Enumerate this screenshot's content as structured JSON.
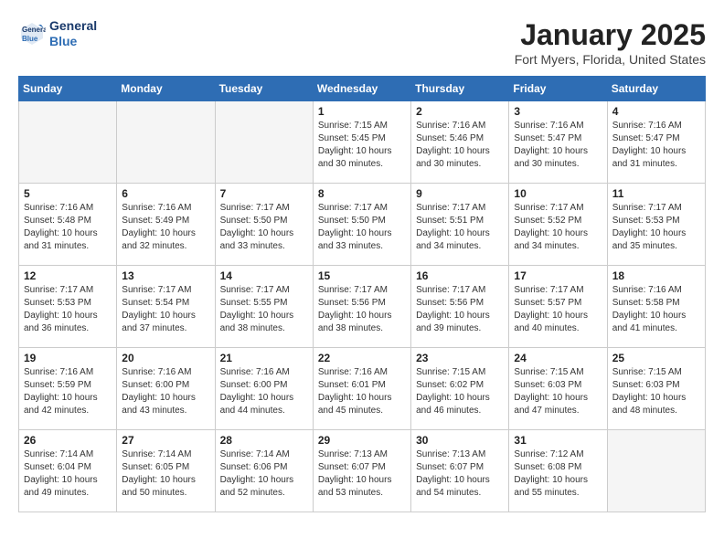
{
  "header": {
    "logo_general": "General",
    "logo_blue": "Blue",
    "title": "January 2025",
    "subtitle": "Fort Myers, Florida, United States"
  },
  "weekdays": [
    "Sunday",
    "Monday",
    "Tuesday",
    "Wednesday",
    "Thursday",
    "Friday",
    "Saturday"
  ],
  "weeks": [
    [
      {
        "day": "",
        "info": ""
      },
      {
        "day": "",
        "info": ""
      },
      {
        "day": "",
        "info": ""
      },
      {
        "day": "1",
        "info": "Sunrise: 7:15 AM\nSunset: 5:45 PM\nDaylight: 10 hours\nand 30 minutes."
      },
      {
        "day": "2",
        "info": "Sunrise: 7:16 AM\nSunset: 5:46 PM\nDaylight: 10 hours\nand 30 minutes."
      },
      {
        "day": "3",
        "info": "Sunrise: 7:16 AM\nSunset: 5:47 PM\nDaylight: 10 hours\nand 30 minutes."
      },
      {
        "day": "4",
        "info": "Sunrise: 7:16 AM\nSunset: 5:47 PM\nDaylight: 10 hours\nand 31 minutes."
      }
    ],
    [
      {
        "day": "5",
        "info": "Sunrise: 7:16 AM\nSunset: 5:48 PM\nDaylight: 10 hours\nand 31 minutes."
      },
      {
        "day": "6",
        "info": "Sunrise: 7:16 AM\nSunset: 5:49 PM\nDaylight: 10 hours\nand 32 minutes."
      },
      {
        "day": "7",
        "info": "Sunrise: 7:17 AM\nSunset: 5:50 PM\nDaylight: 10 hours\nand 33 minutes."
      },
      {
        "day": "8",
        "info": "Sunrise: 7:17 AM\nSunset: 5:50 PM\nDaylight: 10 hours\nand 33 minutes."
      },
      {
        "day": "9",
        "info": "Sunrise: 7:17 AM\nSunset: 5:51 PM\nDaylight: 10 hours\nand 34 minutes."
      },
      {
        "day": "10",
        "info": "Sunrise: 7:17 AM\nSunset: 5:52 PM\nDaylight: 10 hours\nand 34 minutes."
      },
      {
        "day": "11",
        "info": "Sunrise: 7:17 AM\nSunset: 5:53 PM\nDaylight: 10 hours\nand 35 minutes."
      }
    ],
    [
      {
        "day": "12",
        "info": "Sunrise: 7:17 AM\nSunset: 5:53 PM\nDaylight: 10 hours\nand 36 minutes."
      },
      {
        "day": "13",
        "info": "Sunrise: 7:17 AM\nSunset: 5:54 PM\nDaylight: 10 hours\nand 37 minutes."
      },
      {
        "day": "14",
        "info": "Sunrise: 7:17 AM\nSunset: 5:55 PM\nDaylight: 10 hours\nand 38 minutes."
      },
      {
        "day": "15",
        "info": "Sunrise: 7:17 AM\nSunset: 5:56 PM\nDaylight: 10 hours\nand 38 minutes."
      },
      {
        "day": "16",
        "info": "Sunrise: 7:17 AM\nSunset: 5:56 PM\nDaylight: 10 hours\nand 39 minutes."
      },
      {
        "day": "17",
        "info": "Sunrise: 7:17 AM\nSunset: 5:57 PM\nDaylight: 10 hours\nand 40 minutes."
      },
      {
        "day": "18",
        "info": "Sunrise: 7:16 AM\nSunset: 5:58 PM\nDaylight: 10 hours\nand 41 minutes."
      }
    ],
    [
      {
        "day": "19",
        "info": "Sunrise: 7:16 AM\nSunset: 5:59 PM\nDaylight: 10 hours\nand 42 minutes."
      },
      {
        "day": "20",
        "info": "Sunrise: 7:16 AM\nSunset: 6:00 PM\nDaylight: 10 hours\nand 43 minutes."
      },
      {
        "day": "21",
        "info": "Sunrise: 7:16 AM\nSunset: 6:00 PM\nDaylight: 10 hours\nand 44 minutes."
      },
      {
        "day": "22",
        "info": "Sunrise: 7:16 AM\nSunset: 6:01 PM\nDaylight: 10 hours\nand 45 minutes."
      },
      {
        "day": "23",
        "info": "Sunrise: 7:15 AM\nSunset: 6:02 PM\nDaylight: 10 hours\nand 46 minutes."
      },
      {
        "day": "24",
        "info": "Sunrise: 7:15 AM\nSunset: 6:03 PM\nDaylight: 10 hours\nand 47 minutes."
      },
      {
        "day": "25",
        "info": "Sunrise: 7:15 AM\nSunset: 6:03 PM\nDaylight: 10 hours\nand 48 minutes."
      }
    ],
    [
      {
        "day": "26",
        "info": "Sunrise: 7:14 AM\nSunset: 6:04 PM\nDaylight: 10 hours\nand 49 minutes."
      },
      {
        "day": "27",
        "info": "Sunrise: 7:14 AM\nSunset: 6:05 PM\nDaylight: 10 hours\nand 50 minutes."
      },
      {
        "day": "28",
        "info": "Sunrise: 7:14 AM\nSunset: 6:06 PM\nDaylight: 10 hours\nand 52 minutes."
      },
      {
        "day": "29",
        "info": "Sunrise: 7:13 AM\nSunset: 6:07 PM\nDaylight: 10 hours\nand 53 minutes."
      },
      {
        "day": "30",
        "info": "Sunrise: 7:13 AM\nSunset: 6:07 PM\nDaylight: 10 hours\nand 54 minutes."
      },
      {
        "day": "31",
        "info": "Sunrise: 7:12 AM\nSunset: 6:08 PM\nDaylight: 10 hours\nand 55 minutes."
      },
      {
        "day": "",
        "info": ""
      }
    ]
  ]
}
